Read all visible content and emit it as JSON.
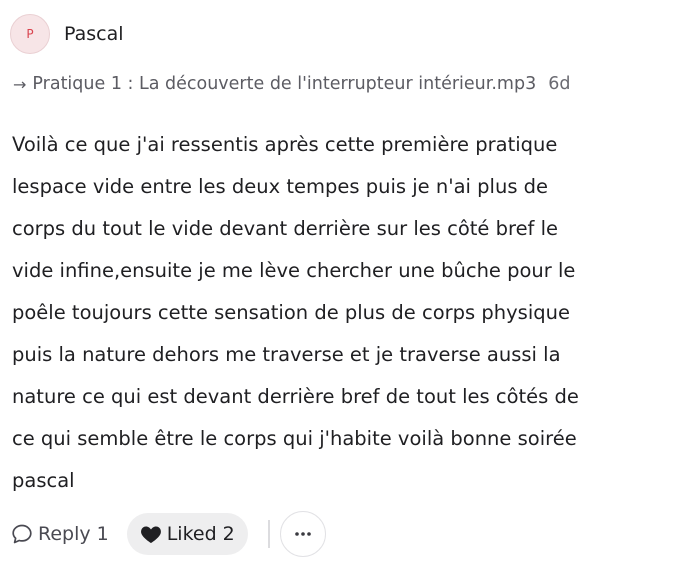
{
  "post": {
    "author": {
      "initial": "P",
      "name": "Pascal"
    },
    "context": {
      "arrow": "→",
      "link_text": "Pratique 1 : La découverte de l'interrupteur intérieur.mp3",
      "age": "6d"
    },
    "body_lines": [
      "Voilà ce que j'ai ressentis après cette première pratique",
      "lespace vide entre les deux tempes puis je n'ai plus de",
      "corps du tout le vide devant derrière sur les côté bref le",
      "vide infine,ensuite je me lève chercher une bûche pour le",
      "poêle toujours cette sensation de plus de corps physique",
      "puis la nature dehors me traverse et je traverse aussi la",
      "nature ce qui est devant derrière bref de tout les côtés de",
      "ce qui semble être le corps qui j'habite voilà bonne soirée",
      "pascal"
    ]
  },
  "actions": {
    "reply_label": "Reply",
    "reply_count": "1",
    "liked_label": "Liked",
    "liked_count": "2",
    "reply_icon": "comment-bubble-icon",
    "liked_icon": "heart-filled-icon",
    "more_icon": "more-horizontal-icon"
  },
  "colors": {
    "avatar_bg": "#f7e5e7",
    "avatar_text": "#d9434e",
    "muted_text": "#5c5c63",
    "pill_bg": "#eeeeef"
  }
}
